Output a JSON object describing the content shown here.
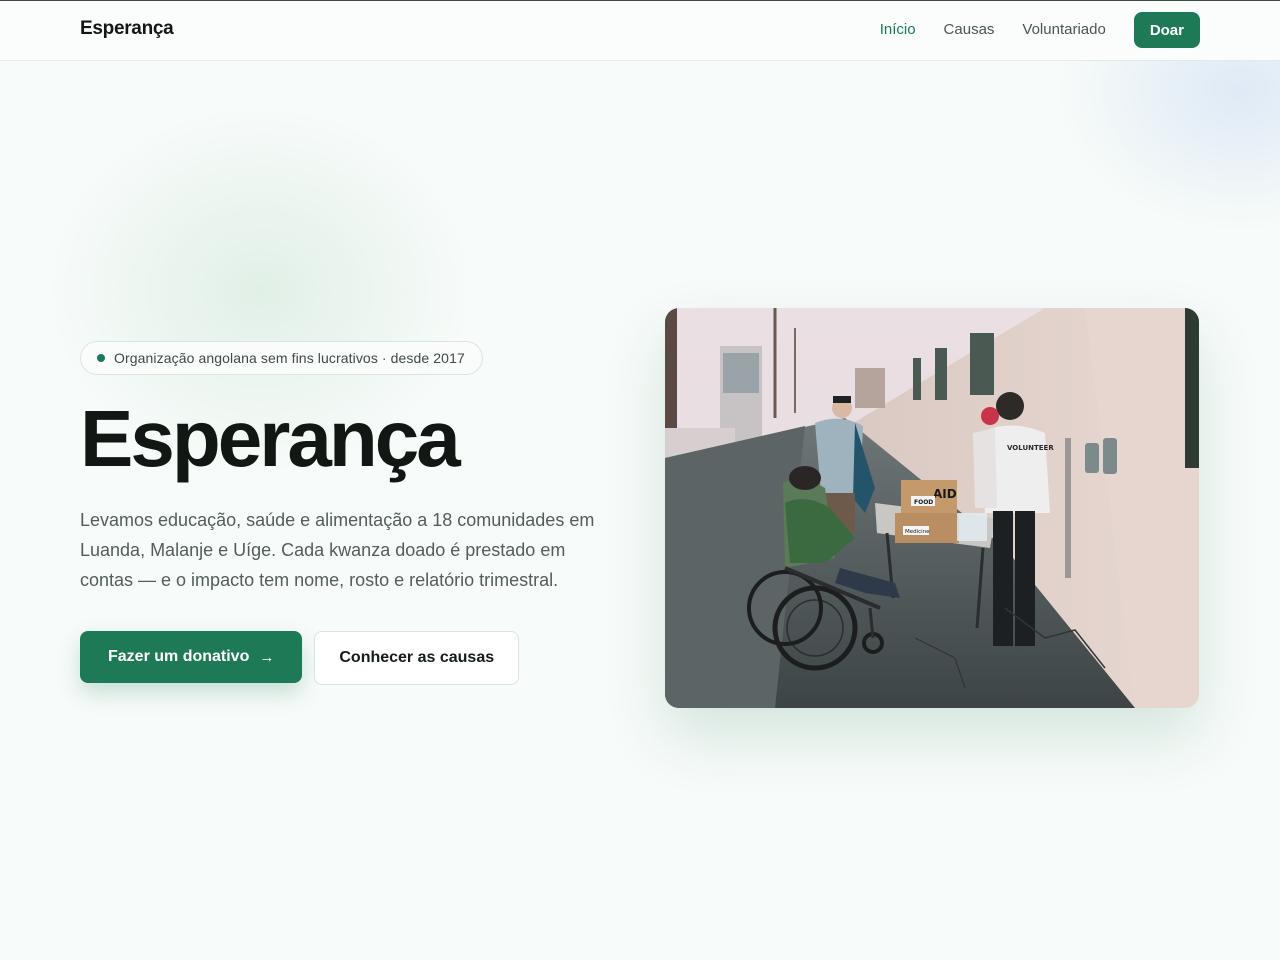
{
  "header": {
    "brand": "Esperança",
    "nav": [
      {
        "label": "Início",
        "active": true
      },
      {
        "label": "Causas",
        "active": false
      },
      {
        "label": "Voluntariado",
        "active": false
      }
    ],
    "donate_label": "Doar"
  },
  "hero": {
    "badge": "Organização angolana sem fins lucrativos · desde 2017",
    "title": "Esperança",
    "lead": "Levamos educação, saúde e alimentação a 18 comunidades em Luanda, Malanje e Uíge. Cada kwanza doado é prestado em contas — e o impacto tem nome, rosto e relatório trimestral.",
    "primary_cta": "Fazer um donativo",
    "secondary_cta": "Conhecer as causas",
    "image_labels": {
      "aid": "AID",
      "food": "FOOD",
      "medicine": "Medicine",
      "volunteer": "VOLUNTEER"
    }
  },
  "icons": {
    "badge_dot": "dot-icon",
    "cta_arrow": "arrow-right-icon"
  },
  "colors": {
    "accent": "#1e7a56",
    "text": "#111814",
    "muted": "#535e58"
  }
}
